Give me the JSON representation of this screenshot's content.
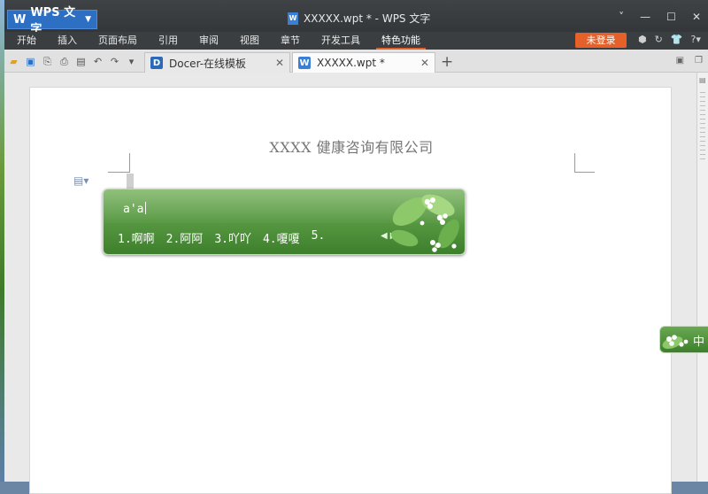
{
  "titlebar": {
    "app_label": "WPS 文字",
    "document_title": "XXXXX.wpt * - WPS 文字",
    "window_controls": [
      "˅",
      "—",
      "☐",
      "✕"
    ]
  },
  "menubar": {
    "items": [
      {
        "label": "开始"
      },
      {
        "label": "插入"
      },
      {
        "label": "页面布局"
      },
      {
        "label": "引用"
      },
      {
        "label": "审阅"
      },
      {
        "label": "视图"
      },
      {
        "label": "章节"
      },
      {
        "label": "开发工具"
      },
      {
        "label": "特色功能",
        "active": true
      }
    ],
    "login_label": "未登录",
    "help_label": "?"
  },
  "tabs": [
    {
      "label": "Docer-在线模板",
      "icon": "D"
    },
    {
      "label": "XXXXX.wpt *",
      "icon": "W"
    }
  ],
  "document": {
    "header_text": "XXXX 健康咨询有限公司"
  },
  "ime": {
    "pinyin": "a'a",
    "candidates": [
      "1.啊啊",
      "2.阿阿",
      "3.吖吖",
      "4.嗄嗄",
      "5."
    ],
    "mini_mode": "中"
  },
  "colors": {
    "accent": "#e6612a",
    "wps_blue": "#2d6fc3",
    "titlebar": "#3a3e41",
    "ime_green": "#5a9a44"
  }
}
